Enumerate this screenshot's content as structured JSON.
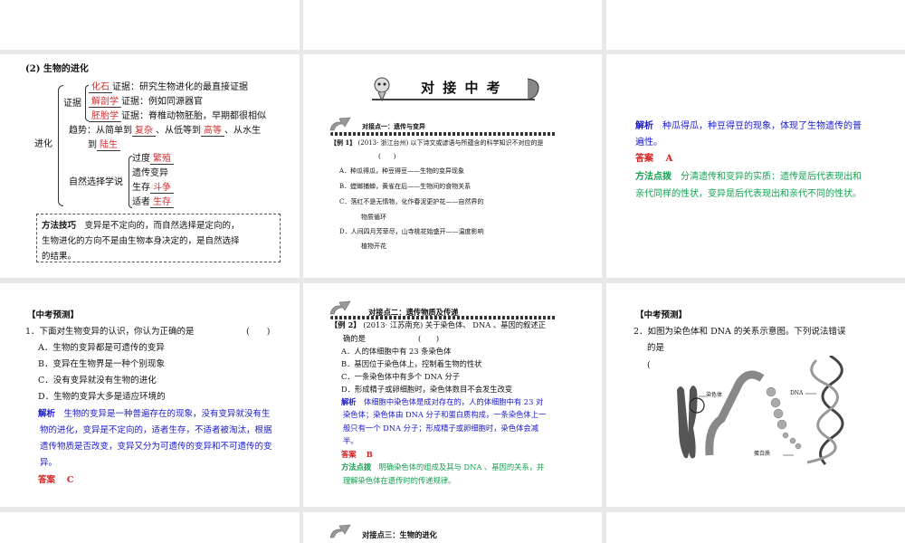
{
  "slide_evolution": {
    "heading": "(2) 生物的进化",
    "root": "进化",
    "evidence_label": "证据",
    "evidence": [
      {
        "blank": "化石",
        "text": "证据：研究生物进化的最直接证据"
      },
      {
        "blank": "解剖学",
        "text": "证据：例如同源器官"
      },
      {
        "blank": "胚胎学",
        "text": "证据：脊椎动物胚胎，早期都很相似"
      }
    ],
    "trend_prefix": "趋势：从简单到",
    "trend_blank1": "复杂",
    "trend_mid": "、从低等到",
    "trend_blank2": "高等",
    "trend_suffix": "、从水生",
    "trend_line2_prefix": "到",
    "trend_blank3": "陆生",
    "selection_label": "自然选择学说",
    "selection": [
      {
        "text": "过度",
        "blank": "繁殖"
      },
      {
        "text": "遗传变异",
        "blank": ""
      },
      {
        "text": "生存",
        "blank": "斗争"
      },
      {
        "text": "适者",
        "blank": "生存"
      }
    ],
    "tip_label": "方法技巧",
    "tip_text1": "变异是不定向的，而自然选择是定向的，",
    "tip_text2": "生物进化的方向不是由生物本身决定的，是自然选择",
    "tip_text3": "的结果。"
  },
  "slide_exam1": {
    "banner_title": "对 接 中 考",
    "point_title": "对接点一：遗传与变异",
    "example_tag": "【例 1】",
    "example_text": "(2013· 浙江台州) 以下诗文或谚语与所蕴含的科学知识不对应的是",
    "paren": "(　　)",
    "options": [
      "A．种瓜得瓜，种豆得豆——生物的变异现象",
      "B．螳螂捕蝉，黄雀在后——生物间的食物关系",
      "C．落红不是无情物，化作春泥更护花——自然界的",
      "物质循环",
      "D．人间四月芳菲尽，山寺桃花始盛开——温度影响",
      "植物开花"
    ]
  },
  "slide_answer1": {
    "analysis_label": "解析",
    "analysis_1": "种瓜得瓜，种豆得豆的现象，体现了生物遗传的普",
    "analysis_2": "遍性。",
    "answer_label": "答案",
    "answer": "A",
    "method_label": "方法点拨",
    "method_1": "分清遗传和变异的实质：遗传是后代表现出和",
    "method_2": "亲代同样的性状，变异是后代表现出和亲代不同的性状。"
  },
  "slide_predict1": {
    "tag": "【中考预测】",
    "question": "1．下面对生物变异的认识，你认为正确的是",
    "paren": "(　　)",
    "options": [
      "A．生物的变异都是可遗传的变异",
      "B．变异在生物界是一种个别现象",
      "C．没有变异就没有生物的进化",
      "D．生物的变异大多是适应环境的"
    ],
    "analysis_label": "解析",
    "analysis_1": "生物的变异是一种普遍存在的现象，没有变异就没有生",
    "analysis_2": "物的进化，变异是不定向的，适者生存，不适者被淘汰，根据",
    "analysis_3": "遗传物质是否改变，变异又分为可遗传的变异和不可遗传的变",
    "analysis_4": "异。",
    "answer_label": "答案",
    "answer": "C"
  },
  "slide_exam2": {
    "point_title": "对接点二：遗传物质及传递",
    "example_tag": "【例 2】",
    "example_text": "(2013· 江苏南充) 关于染色体、 DNA 、基因的叙述正",
    "example_text2": "确的是",
    "paren": "(　　)",
    "options": [
      "A．人的体细胞中有 23 条染色体",
      "B．基因位于染色体上，控制着生物的性状",
      "C．一条染色体中有多个 DNA 分子",
      "D．形成精子或卵细胞时，染色体数目不会发生改变"
    ],
    "analysis_label": "解析",
    "analysis_1": "体细胞中染色体是成对存在的，人的体细胞中有 23 对",
    "analysis_2": "染色体；染色体由 DNA 分子和蛋白质构成，一条染色体上一",
    "analysis_3": "般只有一个 DNA 分子；形成精子或卵细胞时，染色体会减",
    "analysis_4": "半。",
    "answer_label": "答案",
    "answer": "B",
    "method_label": "方法点拨",
    "method_1": "明确染色体的组成及其与 DNA 、基因的关系，并",
    "method_2": "理解染色体在遗传时的传递规律。"
  },
  "slide_predict2": {
    "tag": "【中考预测】",
    "question": "2．如图为染色体和 DNA 的关系示意图。下列说法错误",
    "question2": "的是",
    "paren": "(",
    "figure_labels": {
      "chromosome": "染色体",
      "dna": "DNA",
      "protein": "蛋白质"
    }
  },
  "slide_exam3": {
    "point_title": "对接点三：生物的进化"
  }
}
